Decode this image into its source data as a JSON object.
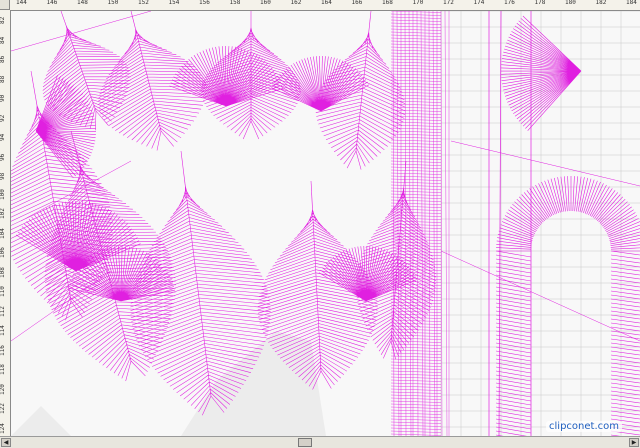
{
  "ruler_top": {
    "labels": [
      "144",
      "146",
      "148",
      "150",
      "152",
      "154",
      "156",
      "158",
      "160",
      "162",
      "164",
      "166",
      "168",
      "170",
      "172",
      "174",
      "176",
      "178",
      "180",
      "182",
      "184"
    ]
  },
  "ruler_left": {
    "labels": [
      "82",
      "84",
      "86",
      "88",
      "90",
      "92",
      "94",
      "96",
      "98",
      "100",
      "102",
      "104",
      "106",
      "108",
      "110",
      "112",
      "114",
      "116",
      "118",
      "120",
      "122",
      "124"
    ]
  },
  "canvas": {
    "stitch_color": "#e020e0",
    "background_color": "#ececec",
    "fabric_color": "#f8f8f8",
    "grid_color": "#c8c8c8"
  },
  "scrollbar": {
    "left_arrow": "◀",
    "right_arrow": "▶"
  },
  "watermark": "clipconet.com"
}
